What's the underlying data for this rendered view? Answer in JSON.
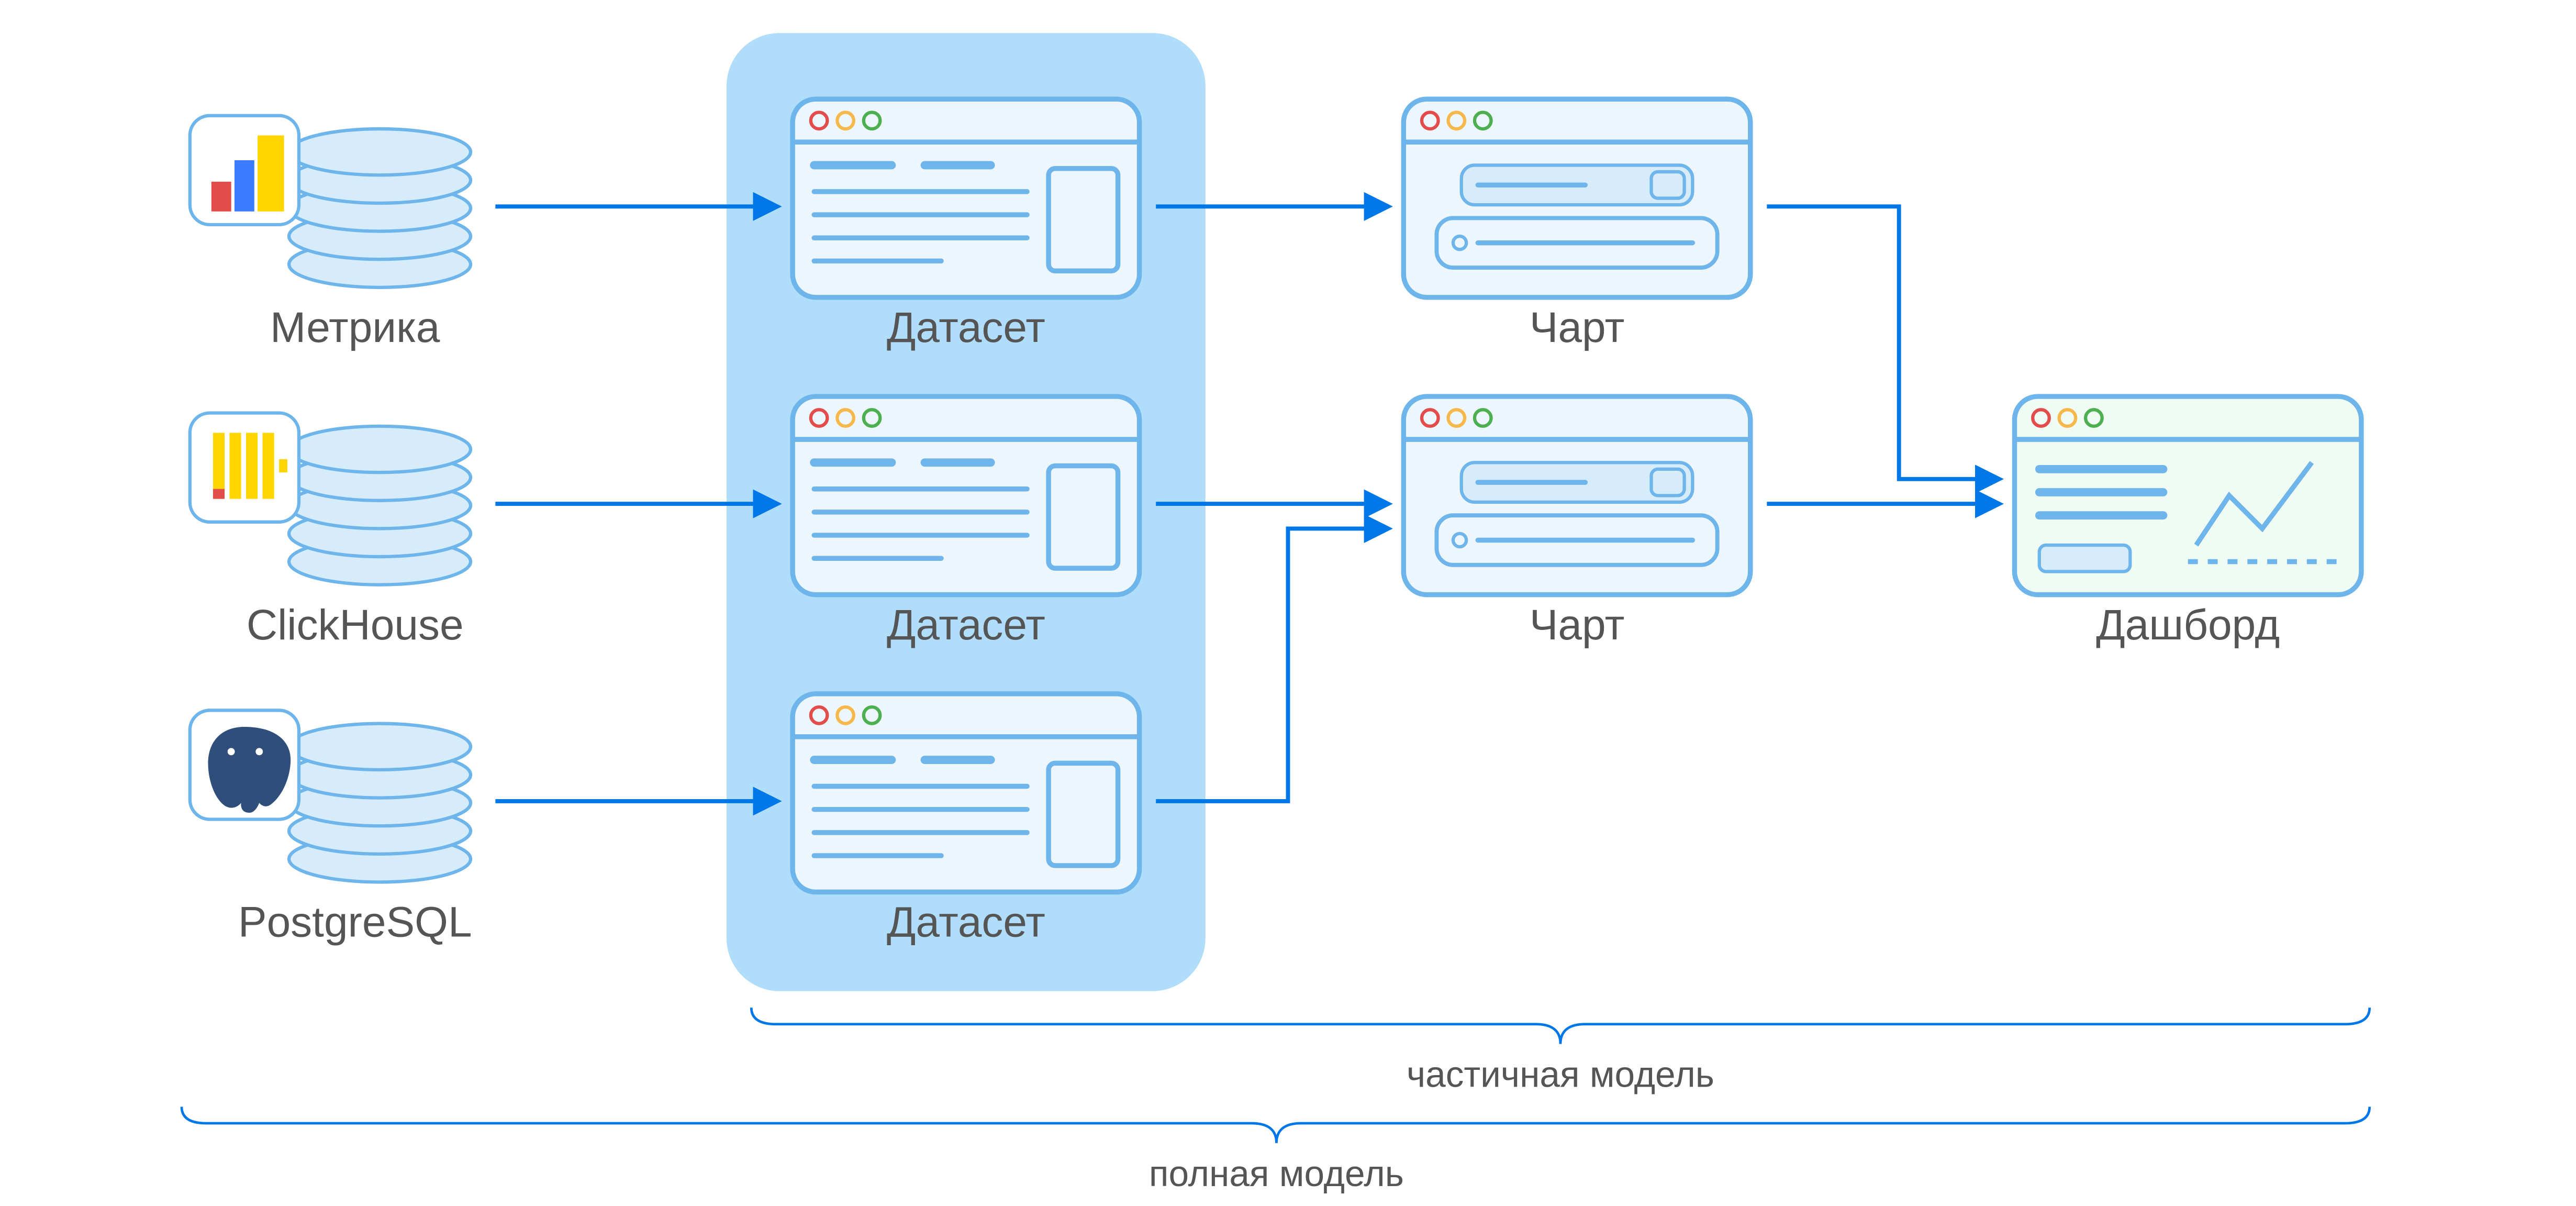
{
  "labels": {
    "source_metrica": "Метрика",
    "source_clickhouse": "ClickHouse",
    "source_postgresql": "PostgreSQL",
    "dataset_1": "Датасет",
    "dataset_2": "Датасет",
    "dataset_3": "Датасет",
    "chart_1": "Чарт",
    "chart_2": "Чарт",
    "dashboard": "Дашборд",
    "brace_partial": "частичная модель",
    "brace_full": "полная модель"
  },
  "colors": {
    "stroke_main": "#0077E6",
    "stroke_light": "#6EB5EB",
    "fill_light": "#D6ECFB",
    "fill_lightest": "#EDF6FD",
    "fill_highlight": "#AFDDFA",
    "fill_dashboard": "#F0FBF3",
    "text": "#555555",
    "dot_red": "#E24C4B",
    "dot_amber": "#F7B84B",
    "dot_green": "#4CAF50",
    "metrica_red": "#E24C4B",
    "metrica_blue": "#3B7CFF",
    "metrica_yellow": "#FFD500",
    "pg_blue": "#2F4E7C"
  }
}
